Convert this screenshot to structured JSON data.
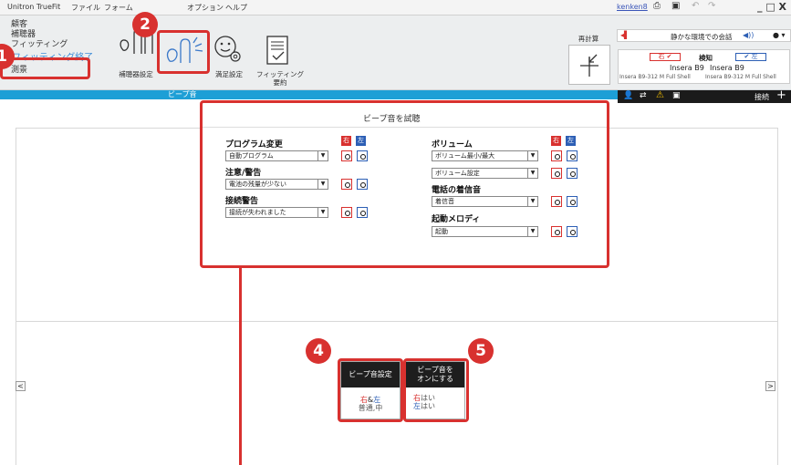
{
  "menubar": {
    "app_title": "Unitron TrueFit",
    "items": [
      "ファイル",
      "フォーム",
      "オプション",
      "ヘルプ"
    ],
    "user": "kenken8",
    "window_controls": "_ □ X"
  },
  "nav": {
    "items": [
      "顧客",
      "補聴器",
      "フィッティング",
      "フィッティング終了",
      "測景"
    ]
  },
  "ribbon": {
    "tools": [
      {
        "label": "補聴器設定",
        "icon": "hearing-aid-settings-icon"
      },
      {
        "label": "",
        "icon": "beep-tone-icon"
      },
      {
        "label": "満足設定",
        "icon": "satisfaction-settings-icon"
      },
      {
        "label": "フィッティング\n要約",
        "icon": "fitting-summary-icon"
      }
    ],
    "recalc_label": "再計算",
    "tab_label": "ビープ音"
  },
  "right_panel": {
    "program": "静かな環境での会話",
    "right_label": "右",
    "detect_label": "検知",
    "left_label": "左",
    "device_right": "Insera B9",
    "device_left": "Insera B9",
    "model_right": "Insera B9-312 M Full Shell",
    "model_left": "Insera B9-312 M Full Shell",
    "connect_label": "接続"
  },
  "beep_panel": {
    "title": "ビープ音を試聴",
    "right_tag": "右",
    "left_tag": "左",
    "program_change": {
      "label": "プログラム変更",
      "value": "自動プログラム"
    },
    "caution": {
      "label": "注意/警告",
      "value": "電池の残量が少ない"
    },
    "connection": {
      "label": "接続警告",
      "value": "接続が失われました"
    },
    "volume": {
      "label": "ボリューム",
      "value1": "ボリューム最小/最大",
      "value2": "ボリューム設定"
    },
    "phone": {
      "label": "電話の着信音",
      "value": "着信音"
    },
    "startup": {
      "label": "起動メロディ",
      "value": "起動"
    }
  },
  "callouts": [
    "1",
    "2",
    "4",
    "5"
  ],
  "cards": {
    "beep_settings": {
      "head": "ビープ音設定",
      "right": "右",
      "amp": "&",
      "left": "左",
      "value": "普通,中"
    },
    "beep_on": {
      "head1": "ビープ音を",
      "head2": "オンにする",
      "right": "右",
      "right_val": "はい",
      "left": "左",
      "left_val": "はい"
    }
  },
  "nav_arrows": {
    "left": "<",
    "right": ">"
  }
}
